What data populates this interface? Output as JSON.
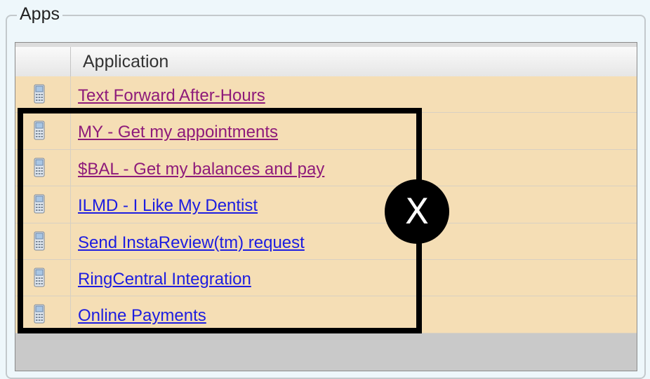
{
  "group": {
    "title": "Apps"
  },
  "grid": {
    "column_header": "Application",
    "rows": [
      {
        "label": "Text Forward After-Hours",
        "visited": true,
        "icon": "phone-icon"
      },
      {
        "label": "MY - Get my appointments",
        "visited": true,
        "icon": "phone-icon"
      },
      {
        "label": "$BAL - Get my balances and pay",
        "visited": true,
        "icon": "phone-icon"
      },
      {
        "label": "ILMD - I Like My Dentist",
        "visited": false,
        "icon": "phone-icon"
      },
      {
        "label": "Send InstaReview(tm) request",
        "visited": false,
        "icon": "phone-icon"
      },
      {
        "label": "RingCentral Integration",
        "visited": false,
        "icon": "phone-icon"
      },
      {
        "label": "Online Payments",
        "visited": false,
        "icon": "phone-icon"
      }
    ]
  },
  "annotation": {
    "badge_text": "X"
  },
  "colors": {
    "row_bg": "#f5deb5",
    "visited_link": "#8e1a7a",
    "link": "#1d1de0"
  }
}
